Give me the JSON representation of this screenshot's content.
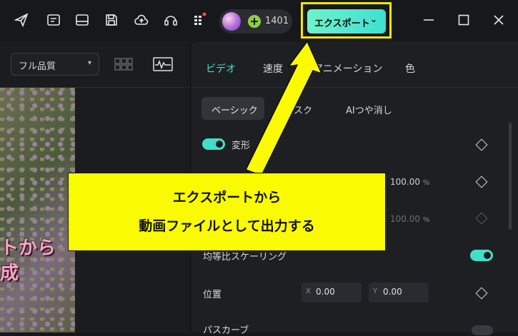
{
  "topbar": {
    "icons": [
      "send-icon",
      "media-library-icon",
      "layout-icon",
      "save-icon",
      "cloud-upload-icon",
      "headset-support-icon",
      "apps-grid-icon"
    ],
    "credits": "1401",
    "export_label": "エクスポート",
    "window_controls": [
      "minimize-icon",
      "maximize-icon",
      "close-icon"
    ]
  },
  "preview": {
    "quality": "フル品質",
    "overlay_line1": "トから",
    "overlay_line2": "成"
  },
  "tabs": [
    "ビデオ",
    "速度",
    "アニメーション",
    "色"
  ],
  "subtabs": [
    "ベーシック",
    "マスク",
    "AIつや消し"
  ],
  "properties": {
    "transform_label": "変形",
    "scale_x": "100.00",
    "scale_y": "100.00",
    "pct_unit": "%",
    "uniform_scaling_label": "均等比スケーリング",
    "position_label": "位置",
    "pos_x_key": "X",
    "pos_x": "0.00",
    "pos_y_key": "Y",
    "pos_y": "0.00",
    "path_curve_label": "パスカーブ"
  },
  "callout": {
    "line1": "エクスポートから",
    "line2": "動画ファイルとして出力する"
  },
  "colors": {
    "accent": "#3fe0c7",
    "callout": "#fbfb00",
    "highlight_frame": "#f0ea00"
  }
}
